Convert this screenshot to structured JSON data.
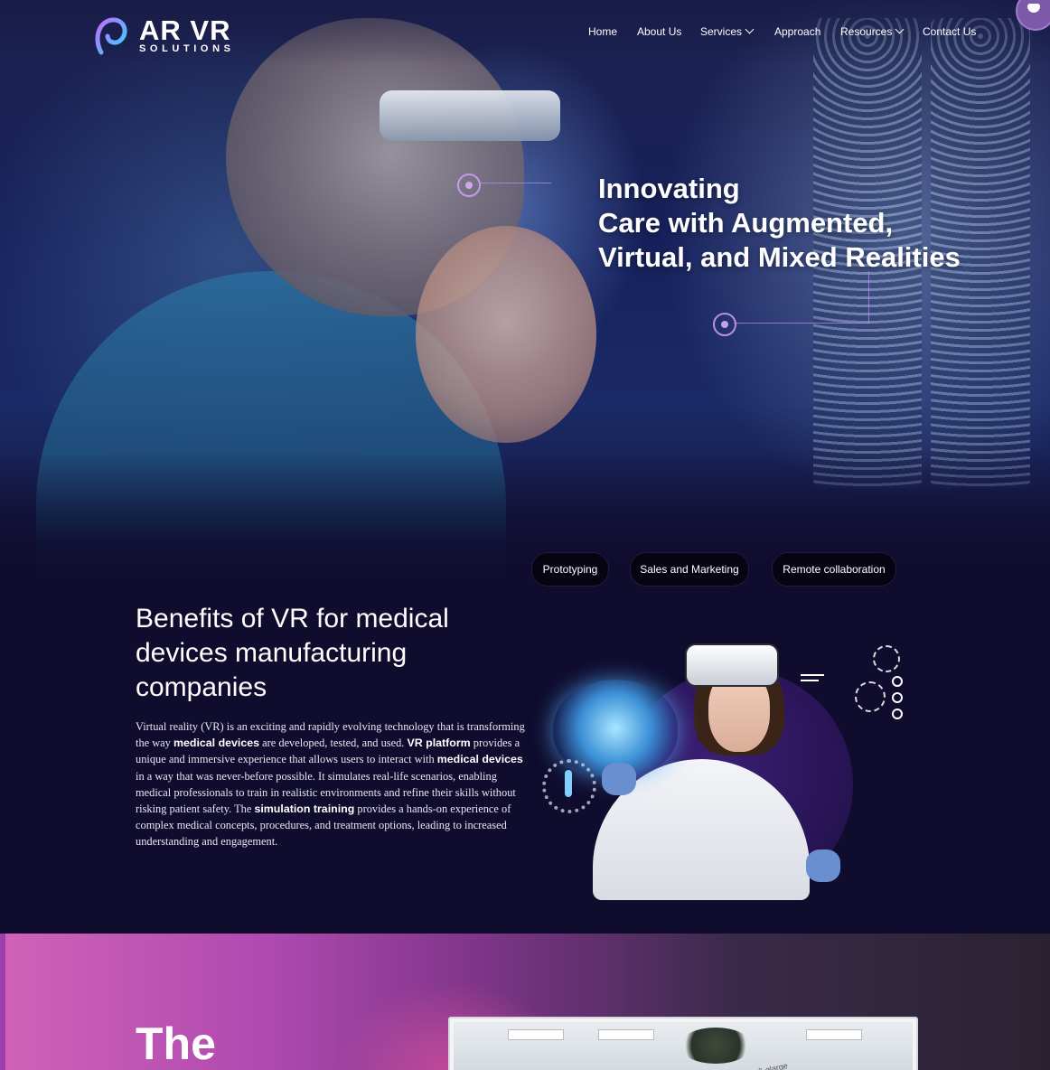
{
  "nav": {
    "logo_main": "AR VR",
    "logo_sub": "SOLUTIONS",
    "items": [
      {
        "label": "Home"
      },
      {
        "label": "About Us"
      },
      {
        "label": "Services"
      },
      {
        "label": "Approach"
      },
      {
        "label": "Resources"
      },
      {
        "label": "Contact Us"
      }
    ]
  },
  "hero": {
    "title_lines": [
      "Innovating",
      "Care with Augmented,",
      "Virtual, and Mixed Realities"
    ]
  },
  "pills": [
    "Prototyping",
    "Sales and Marketing",
    "Remote collaboration"
  ],
  "benefits": {
    "title": "Benefits of VR for medical devices manufacturing companies",
    "p1": "Virtual reality (VR) is an exciting and rapidly evolving technology that is transforming the way ",
    "b1": "medical devices",
    "p2": " are developed, tested, and used. ",
    "b2": "VR platform",
    "p3": " provides a unique and immersive experience that allows users to interact with ",
    "b3": "medical devices",
    "p4": " in a way that was never-before possible. It simulates real-life scenarios, enabling medical professionals to train in realistic environments and refine their skills without risking patient safety. The ",
    "b4": "simulation training",
    "p5": " provides a hands-on experience of complex medical concepts, procedures, and treatment options, leading to increased understanding and engagement."
  },
  "bottom": {
    "title": "The",
    "video_caption": "ble & elarge"
  },
  "colors": {
    "page_bg": "#0f0c2e",
    "pill_bg": "#050410",
    "accent_purple": "#2a1558",
    "bottom_pink": "#d062b8"
  },
  "icons": {
    "logo": "arvr-logo-icon",
    "chevron": "chevron-down-icon",
    "corner": "chat-avatar-icon"
  }
}
